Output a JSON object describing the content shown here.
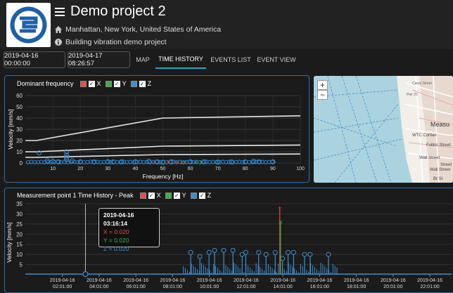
{
  "header": {
    "title": "Demo project 2",
    "location": "Manhattan, New York, United States of America",
    "description": "Building vibration demo project"
  },
  "toolbar": {
    "date_from": "2019-04-16 00:00:00",
    "date_to": "2019-04-17 08:26:57",
    "tabs": [
      {
        "label": "MAP",
        "active": false
      },
      {
        "label": "TIME HISTORY",
        "active": true
      },
      {
        "label": "EVENTS LIST",
        "active": false
      },
      {
        "label": "EVENT VIEW",
        "active": false
      }
    ]
  },
  "colors": {
    "accent": "#2a9fd6",
    "x": "#e05050",
    "y": "#3cb043",
    "z": "#3a8fd6"
  },
  "map": {
    "zoom_in": "+",
    "zoom_out": "−",
    "labels": [
      "Measu",
      "WTC Cortlan",
      "Wall Street",
      "Wall Street",
      "Fulton Street",
      "Br St",
      "Street",
      "Pier 25",
      "Canal Street"
    ]
  },
  "chart_data": [
    {
      "type": "scatter",
      "title": "Dominant frequency",
      "legend": [
        "X",
        "Y",
        "Z"
      ],
      "xlabel": "Frequency [Hz]",
      "ylabel": "Velocity [mm/s]",
      "xlim": [
        0,
        100
      ],
      "ylim": [
        0,
        60
      ],
      "x_ticks": [
        "10",
        "20",
        "30",
        "40",
        "50",
        "60",
        "70",
        "80",
        "90",
        "100"
      ],
      "y_ticks": [
        "0",
        "10",
        "20",
        "30",
        "40",
        "50",
        "60"
      ],
      "limit_lines": [
        {
          "x": [
            0,
            4,
            50,
            100
          ],
          "y": [
            20,
            20,
            40,
            42
          ]
        },
        {
          "x": [
            0,
            4,
            50,
            100
          ],
          "y": [
            10,
            10,
            15,
            16
          ]
        },
        {
          "x": [
            0,
            4,
            50,
            100
          ],
          "y": [
            5,
            5,
            7.5,
            8
          ]
        }
      ],
      "z_points": [
        [
          5,
          9
        ],
        [
          8,
          2
        ],
        [
          10,
          1.5
        ],
        [
          12,
          1
        ],
        [
          15,
          3
        ],
        [
          15,
          5
        ],
        [
          15,
          7
        ],
        [
          15,
          10
        ],
        [
          17,
          2
        ],
        [
          20,
          1
        ],
        [
          25,
          1
        ],
        [
          30,
          1.2
        ],
        [
          32,
          1
        ],
        [
          35,
          1
        ],
        [
          40,
          1
        ],
        [
          45,
          1.5
        ],
        [
          48,
          1
        ],
        [
          50,
          0.5
        ],
        [
          53,
          1
        ],
        [
          60,
          1
        ],
        [
          65,
          1
        ],
        [
          70,
          0.8
        ],
        [
          75,
          1
        ],
        [
          80,
          1
        ],
        [
          83,
          1.5
        ],
        [
          85,
          1
        ],
        [
          90,
          1
        ]
      ],
      "x_points": [
        [
          47,
          0.5
        ],
        [
          52,
          1
        ],
        [
          55,
          0.5
        ],
        [
          57,
          0.3
        ]
      ],
      "y_points": [
        [
          58,
          0.5
        ],
        [
          62,
          0.5
        ],
        [
          64,
          0.5
        ]
      ]
    },
    {
      "type": "line",
      "title": "Measurement point 1 Time History - Peak",
      "legend": [
        "X",
        "Y",
        "Z"
      ],
      "ylabel": "Velocity [mm/s]",
      "ylim": [
        0,
        35
      ],
      "y_ticks": [
        "5",
        "10",
        "15",
        "20",
        "25",
        "30",
        "35"
      ],
      "x_ticks": [
        [
          "2019-04-16",
          "02:01:00"
        ],
        [
          "2019-04-16",
          "04:01:00"
        ],
        [
          "2019-04-16",
          "06:01:00"
        ],
        [
          "2019-04-16",
          "08:01:00"
        ],
        [
          "2019-04-16",
          "10:01:00"
        ],
        [
          "2019-04-16",
          "12:01:00"
        ],
        [
          "2019-04-16",
          "14:01:00"
        ],
        [
          "2019-04-16",
          "16:01:00"
        ],
        [
          "2019-04-16",
          "18:01:00"
        ],
        [
          "2019-04-16",
          "20:01:00"
        ],
        [
          "2019-04-16",
          "22:01:00"
        ]
      ],
      "x_range_hours": [
        0,
        23.2
      ],
      "z_spikes": [
        [
          9.0,
          11
        ],
        [
          9.5,
          9
        ],
        [
          10.0,
          11
        ],
        [
          10.3,
          12
        ],
        [
          10.8,
          12
        ],
        [
          11.3,
          12
        ],
        [
          11.8,
          10
        ],
        [
          12.0,
          11
        ],
        [
          12.7,
          11
        ],
        [
          13.1,
          10
        ],
        [
          13.6,
          11
        ],
        [
          14.0,
          8
        ],
        [
          14.3,
          11
        ],
        [
          14.6,
          11
        ],
        [
          15.2,
          10
        ],
        [
          15.5,
          10
        ],
        [
          16.5,
          10
        ]
      ],
      "x_spike": [
        13.85,
        33
      ],
      "y_spike": [
        13.85,
        26
      ],
      "tooltip": {
        "time": "2019-04-16 03:16:14",
        "x": "X = 0.020",
        "y": "Y = 0.020",
        "z": "Z = 0.020",
        "hour": 3.27
      }
    }
  ]
}
